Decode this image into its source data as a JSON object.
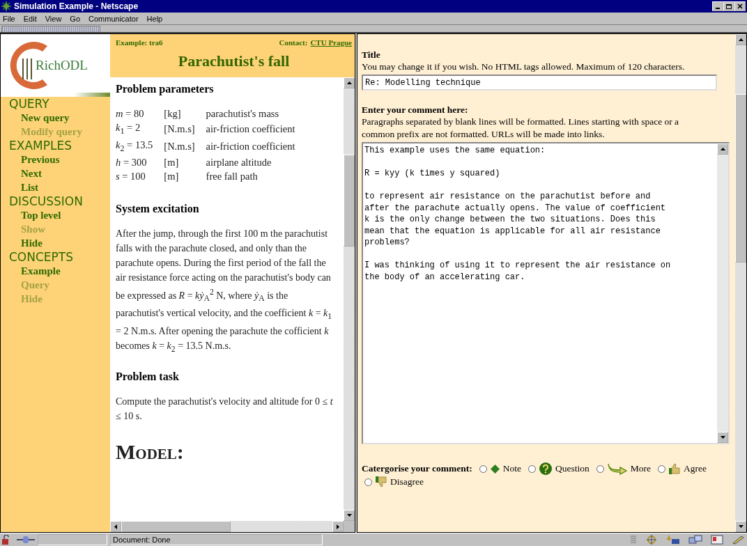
{
  "window": {
    "title": "Simulation Example - Netscape"
  },
  "menu": [
    "File",
    "Edit",
    "View",
    "Go",
    "Communicator",
    "Help"
  ],
  "logo": {
    "text": "RichODL"
  },
  "nav": [
    {
      "heading": "QUERY",
      "items": [
        {
          "label": "New query",
          "disabled": false
        },
        {
          "label": "Modify query",
          "disabled": true
        }
      ]
    },
    {
      "heading": "EXAMPLES",
      "items": [
        {
          "label": "Previous",
          "disabled": false
        },
        {
          "label": "Next",
          "disabled": false
        },
        {
          "label": "List",
          "disabled": false
        }
      ]
    },
    {
      "heading": "DISCUSSION",
      "items": [
        {
          "label": "Top level",
          "disabled": false
        },
        {
          "label": "Show",
          "disabled": true
        },
        {
          "label": "Hide",
          "disabled": false
        }
      ]
    },
    {
      "heading": "CONCEPTS",
      "items": [
        {
          "label": "Example",
          "disabled": false
        },
        {
          "label": "Query",
          "disabled": true
        },
        {
          "label": "Hide",
          "disabled": true
        }
      ]
    }
  ],
  "header": {
    "example": "Example: tra6",
    "contact_label": "Contact:",
    "contact_link": "CTU Prague",
    "title": "Parachutist's fall"
  },
  "sections": [
    {
      "kind": "params",
      "heading": "Problem parameters",
      "rows": [
        {
          "symbol": "*m* = 80",
          "unit": "[kg]",
          "description": "parachutist's mass"
        },
        {
          "symbol": "*k*$_{1}$ = 2",
          "unit": "[N.m.s]",
          "description": "air-friction coefficient"
        },
        {
          "symbol": "*k*$_{2}$ = 13.5",
          "unit": "[N.m.s]",
          "description": "air-friction coefficient"
        },
        {
          "symbol": "*h* = 300",
          "unit": "[m]",
          "description": "airplane altitude"
        },
        {
          "symbol": "*s* = 100",
          "unit": "[m]",
          "description": "free fall path"
        }
      ]
    },
    {
      "kind": "text",
      "heading": "System excitation",
      "paragraphs": [
        "After the jump, through the first 100 m the parachutist falls with the parachute closed, and only than the parachute opens. During the first period of the fall the air resistance force acting on the parachutist's body can be expressed as *R* = *kẏ*$_{A}$$^{2}$ N, where *ẏ*$_{A}$ is the parachutist's vertical velocity, and the coefficient *k* = *k*$_{1}$ = 2 N.m.s. After opening the parachute the cofficient *k* becomes *k* = *k*$_{2}$ = 13.5 N.m.s."
      ]
    },
    {
      "kind": "text",
      "heading": "Problem task",
      "paragraphs": [
        "Compute the parachutist's velocity and altitude for 0 ≤ *t* ≤ 10 s."
      ]
    },
    {
      "kind": "title",
      "heading": "Model:"
    }
  ],
  "form": {
    "title_label": "Title",
    "title_help": "You may change it if you wish. No HTML tags allowed. Maximum of 120 characters.",
    "title_value": "Re: Modelling technique",
    "comment_label": "Enter your comment here:",
    "comment_help": "Paragraphs separated by blank lines will be formatted. Lines starting with space or a common prefix are not formatted. URLs will be made into links.",
    "comment_value": "This example uses the same equation:\n\nR = kyy (k times y squared)\n\nto represent air resistance on the parachutist before and\nafter the parachute actually opens. The value of coefficient\nk is the only change between the two situations. Does this\nmean that the equation is applicable for all air resistance\nproblems?\n\nI was thinking of using it to represent the air resistance on\nthe body of an accelerating car.",
    "category_label": "Catergorise your comment:",
    "categories": [
      {
        "kind": "note",
        "label": "Note",
        "selected": false
      },
      {
        "kind": "question",
        "label": "Question",
        "selected": false
      },
      {
        "kind": "more",
        "label": "More",
        "selected": false
      },
      {
        "kind": "agree",
        "label": "Agree",
        "selected": false
      },
      {
        "kind": "disagree",
        "label": "Disagree",
        "selected": false
      }
    ]
  },
  "status_bar": {
    "text": "Document: Done"
  }
}
